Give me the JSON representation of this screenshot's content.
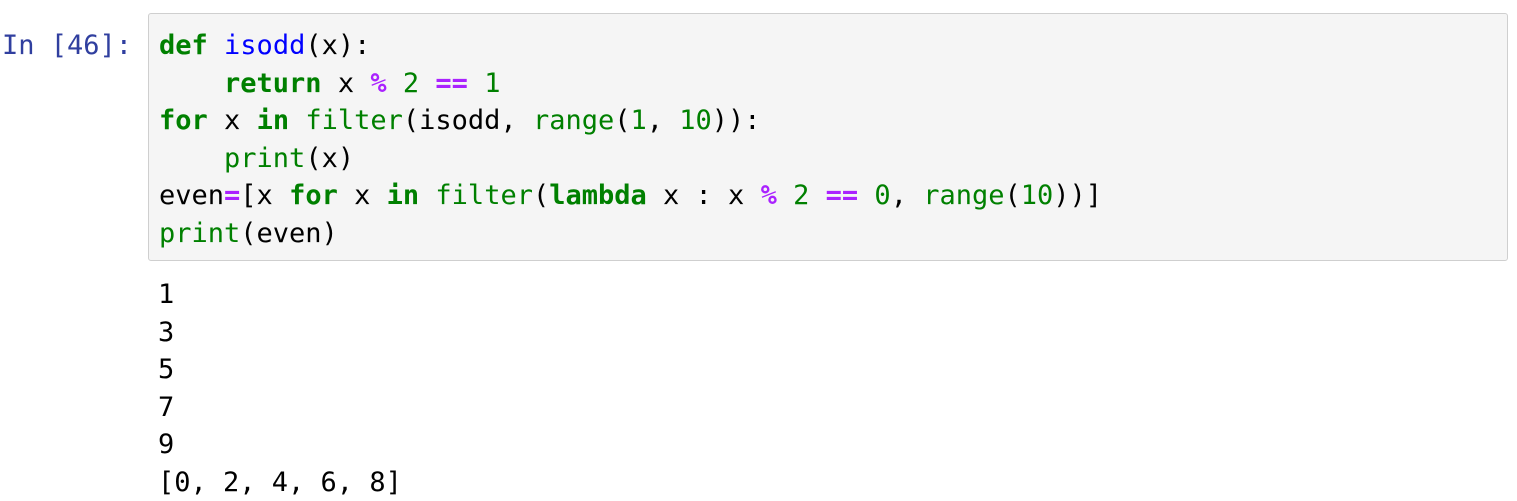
{
  "cell": {
    "prompt": "In [46]:",
    "code_lines": [
      [
        {
          "t": "def",
          "c": "kw"
        },
        {
          "t": " ",
          "c": ""
        },
        {
          "t": "isodd",
          "c": "fn"
        },
        {
          "t": "(x):",
          "c": ""
        }
      ],
      [
        {
          "t": "    ",
          "c": ""
        },
        {
          "t": "return",
          "c": "kw"
        },
        {
          "t": " x ",
          "c": ""
        },
        {
          "t": "%",
          "c": "op"
        },
        {
          "t": " ",
          "c": ""
        },
        {
          "t": "2",
          "c": "num"
        },
        {
          "t": " ",
          "c": ""
        },
        {
          "t": "==",
          "c": "op"
        },
        {
          "t": " ",
          "c": ""
        },
        {
          "t": "1",
          "c": "num"
        }
      ],
      [
        {
          "t": "for",
          "c": "kw"
        },
        {
          "t": " x ",
          "c": ""
        },
        {
          "t": "in",
          "c": "kw"
        },
        {
          "t": " ",
          "c": ""
        },
        {
          "t": "filter",
          "c": "bi"
        },
        {
          "t": "(isodd, ",
          "c": ""
        },
        {
          "t": "range",
          "c": "bi"
        },
        {
          "t": "(",
          "c": ""
        },
        {
          "t": "1",
          "c": "num"
        },
        {
          "t": ", ",
          "c": ""
        },
        {
          "t": "10",
          "c": "num"
        },
        {
          "t": ")):",
          "c": ""
        }
      ],
      [
        {
          "t": "    ",
          "c": ""
        },
        {
          "t": "print",
          "c": "bi"
        },
        {
          "t": "(x)",
          "c": ""
        }
      ],
      [
        {
          "t": "even",
          "c": ""
        },
        {
          "t": "=",
          "c": "op"
        },
        {
          "t": "[x ",
          "c": ""
        },
        {
          "t": "for",
          "c": "kw"
        },
        {
          "t": " x ",
          "c": ""
        },
        {
          "t": "in",
          "c": "kw"
        },
        {
          "t": " ",
          "c": ""
        },
        {
          "t": "filter",
          "c": "bi"
        },
        {
          "t": "(",
          "c": ""
        },
        {
          "t": "lambda",
          "c": "kw"
        },
        {
          "t": " x : x ",
          "c": ""
        },
        {
          "t": "%",
          "c": "op"
        },
        {
          "t": " ",
          "c": ""
        },
        {
          "t": "2",
          "c": "num"
        },
        {
          "t": " ",
          "c": ""
        },
        {
          "t": "==",
          "c": "op"
        },
        {
          "t": " ",
          "c": ""
        },
        {
          "t": "0",
          "c": "num"
        },
        {
          "t": ", ",
          "c": ""
        },
        {
          "t": "range",
          "c": "bi"
        },
        {
          "t": "(",
          "c": ""
        },
        {
          "t": "10",
          "c": "num"
        },
        {
          "t": "))]",
          "c": ""
        }
      ],
      [
        {
          "t": "print",
          "c": "bi"
        },
        {
          "t": "(even)",
          "c": ""
        }
      ]
    ],
    "output_lines": [
      "1",
      "3",
      "5",
      "7",
      "9",
      "[0, 2, 4, 6, 8]"
    ]
  },
  "colors": {
    "prompt": "#303f9f",
    "keyword": "#008000",
    "builtin": "#008000",
    "function_name": "#0000ff",
    "number": "#008000",
    "operator": "#aa22ff",
    "input_background": "#f5f5f5",
    "input_border": "#cfcfcf"
  }
}
